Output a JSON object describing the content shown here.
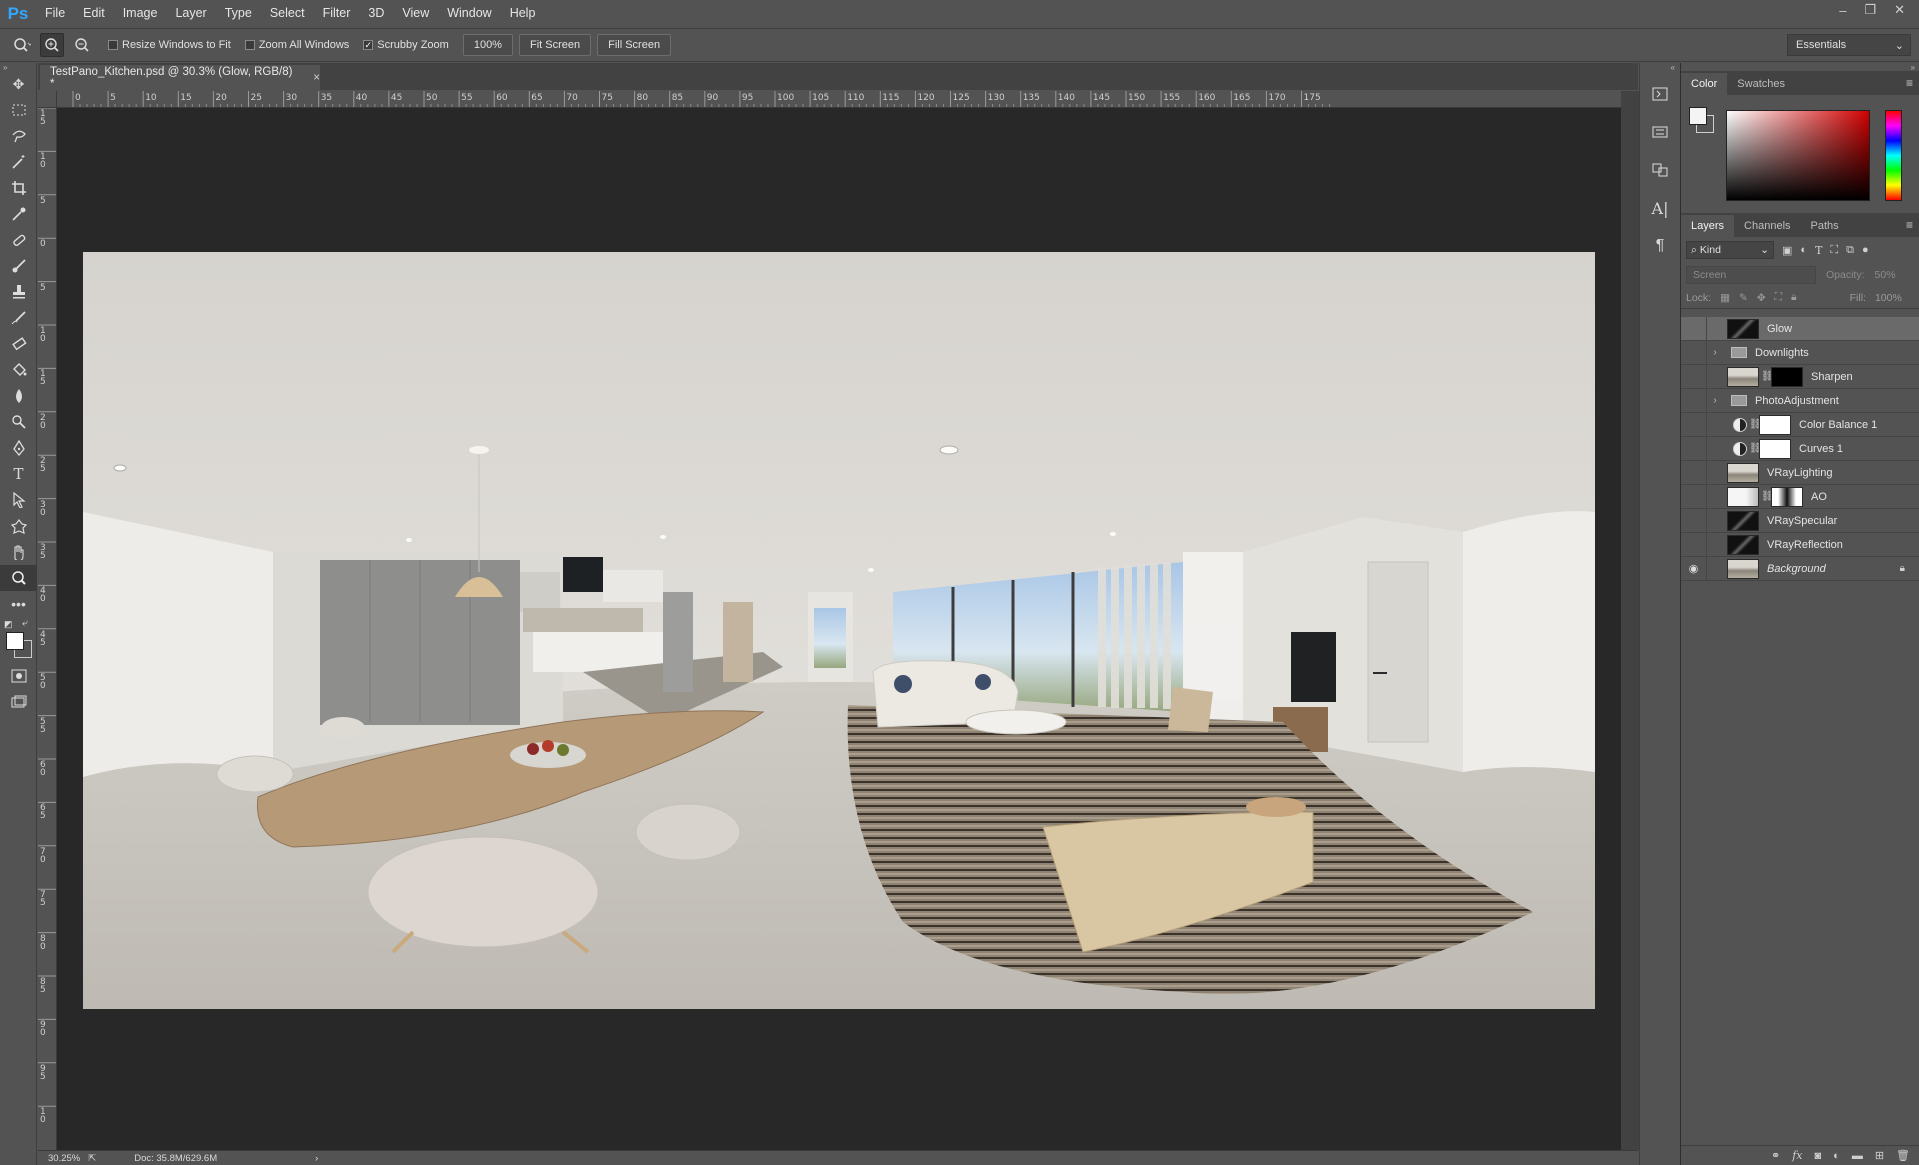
{
  "app": {
    "logo": "Ps"
  },
  "menu": [
    "File",
    "Edit",
    "Image",
    "Layer",
    "Type",
    "Select",
    "Filter",
    "3D",
    "View",
    "Window",
    "Help"
  ],
  "window_controls": {
    "minimize": "–",
    "restore": "❐",
    "close": "✕"
  },
  "options": {
    "resize_windows": "Resize Windows to Fit",
    "zoom_all": "Zoom All Windows",
    "scrubby_zoom": "Scrubby Zoom",
    "scrubby_checked": true,
    "zoom_value": "100%",
    "fit_screen": "Fit Screen",
    "fill_screen": "Fill Screen",
    "workspace": "Essentials"
  },
  "document": {
    "tab_title": "TestPano_Kitchen.psd @ 30.3% (Glow, RGB/8) *",
    "close": "×"
  },
  "ruler": {
    "top_labels": [
      "0",
      "5",
      "10",
      "15",
      "20",
      "25",
      "30",
      "35",
      "40",
      "45",
      "50",
      "55",
      "60",
      "65",
      "70",
      "75",
      "80",
      "85",
      "90",
      "95",
      "100",
      "105",
      "110",
      "115",
      "120",
      "125",
      "130",
      "135",
      "140",
      "145",
      "150",
      "155",
      "160",
      "165",
      "170",
      "175"
    ],
    "left_labels": [
      "1 5",
      "1 0",
      "5",
      "0",
      "5",
      "1 0",
      "1 5",
      "2 0",
      "2 5",
      "3 0",
      "3 5",
      "4 0",
      "4 5",
      "5 0",
      "5 5",
      "6 0",
      "6 5",
      "7 0",
      "7 5",
      "8 0",
      "8 5",
      "9 0",
      "9 5",
      "1 0"
    ]
  },
  "status": {
    "zoom": "30.25%",
    "doc": "Doc: 35.8M/629.6M"
  },
  "color_panel": {
    "tabs": [
      "Color",
      "Swatches"
    ],
    "active_tab": "Color",
    "fg_color": "#f4f4f4",
    "hue_color": "#d10000"
  },
  "layers_panel": {
    "tabs": [
      "Layers",
      "Channels",
      "Paths"
    ],
    "active_tab": "Layers",
    "kind": "Kind",
    "blend_mode": "Screen",
    "opacity_label": "Opacity:",
    "opacity_value": "50%",
    "lock_label": "Lock:",
    "fill_label": "Fill:",
    "fill_value": "100%",
    "layers": [
      {
        "name": "Glow",
        "type": "pixel",
        "visible": false,
        "selected": true,
        "thumb": "dark",
        "mask": null
      },
      {
        "name": "Downlights",
        "type": "group",
        "visible": false
      },
      {
        "name": "Sharpen",
        "type": "pixel",
        "visible": false,
        "thumb": "photo",
        "mask": "black"
      },
      {
        "name": "PhotoAdjustment",
        "type": "group",
        "visible": false
      },
      {
        "name": "Color Balance 1",
        "type": "adjustment",
        "visible": false,
        "mask": "white"
      },
      {
        "name": "Curves 1",
        "type": "adjustment",
        "visible": false,
        "mask": "white"
      },
      {
        "name": "VRayLighting",
        "type": "pixel",
        "visible": false,
        "thumb": "photo"
      },
      {
        "name": "AO",
        "type": "pixel",
        "visible": false,
        "thumb": "light",
        "mask": "mixed"
      },
      {
        "name": "VRaySpecular",
        "type": "pixel",
        "visible": false,
        "thumb": "dark"
      },
      {
        "name": "VRayReflection",
        "type": "pixel",
        "visible": false,
        "thumb": "dark"
      },
      {
        "name": "Background",
        "type": "pixel",
        "visible": true,
        "thumb": "photo",
        "locked": true,
        "italic": true
      }
    ]
  }
}
